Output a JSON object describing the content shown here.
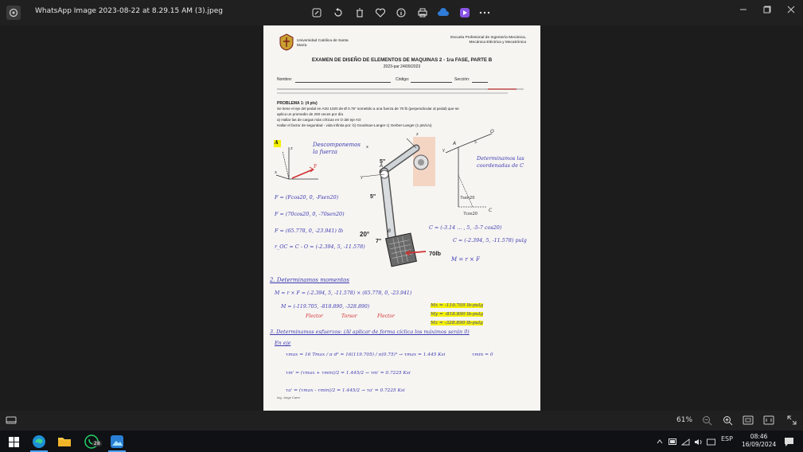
{
  "window": {
    "title": "WhatsApp Image 2023-08-22 at 8.29.15 AM (3).jpeg",
    "toolbar_icons": [
      "edit-icon",
      "rotate-icon",
      "delete-icon",
      "favorite-icon",
      "info-icon",
      "print-icon",
      "cloud-icon",
      "clipchamp-icon",
      "more-icon"
    ]
  },
  "status": {
    "zoom": "61%"
  },
  "taskbar": {
    "lang": "ESP",
    "time": "08:46",
    "date": "16/09/2024",
    "whatsapp_badge": "28"
  },
  "document": {
    "university": "Universidad Católica de Santa María",
    "school": "Escuela Profesional de Ingeniería Mecánica, Mecánica Eléctrica y Mecatrónica",
    "exam_title": "EXAMEN DE DISEÑO DE ELEMENTOS DE MAQUINAS 2 - 1ra FASE, PARTE B",
    "semester": "2023-par    24/09/2023",
    "name_label": "Nombre:",
    "code_label": "Código:",
    "section_label": "Sección:",
    "problem_title": "PROBLEMA 1: (4 pts)",
    "problem_line1": "Se tiene el eje del pedal en AISI 1020 de Ø 0.75\" sometido a una fuerza de 70 lb (perpendicular al pedal) que se",
    "problem_line2": "aplica un promedio de 200 veces por día",
    "problem_line3": "a) Hallar las de cargas más críticas en O del eje AO",
    "problem_line4": "Hallar el factor de seguridad - vida infinita por: b) Goodman-Langer c) Gerber-Langer (1 pts/c/u)",
    "label_force": "70lb",
    "label_5a": "5\"",
    "label_5b": "5\"",
    "label_7": "7\"",
    "label_20": "20°",
    "hw_descompose": "Descomponemos la fuerza",
    "hw_coords": "Determinamos las coordenadas de C",
    "hw_F1": "F = (Fcos20, 0, -Fsen20)",
    "hw_F2": "F = (70cos20, 0, -70sen20)",
    "hw_F3": "F = (65.778, 0, -23.941) lb",
    "hw_roc": "r_OC = C - O = (-2.394, 5, -11.578)",
    "hw_C": "C = (-3.14 ... , 5, -5-7 cos20)",
    "hw_C2": "C = (-2.394, 5, -11.578) pulg",
    "hw_M": "M = r × F",
    "hw_moments": "2. Determinamos momentos",
    "hw_Mcalc": "M = r × F = (-2.394, 5, -11.578) × (65.778, 0, -23.941)",
    "hw_Mres": "M = (-119.705, -818.890, -328.890)",
    "hw_flector": "Flector",
    "hw_torsor": "Torsor",
    "hw_flector2": "Flector",
    "hw_Mx": "Mx = -119.705 lb-pulg",
    "hw_My": "My = -818.890 lb-pulg",
    "hw_Mz": "Mz = -328.890 lb-pulg",
    "hw_stress": "3. Determinamos esfuerzos: (Al aplicar de forma cíclica los máximos serán 0)",
    "hw_tmax": "τmax = 16 Tmax / π d³ = 16(119.705) / π(0.75)³ → τmax = 1.445 Ksi",
    "hw_tmin": "τmin = 0",
    "hw_tm": "τm' = (τmax + τmin)/2 = 1.445/2 → τm' = 0.7225 Ksi",
    "hw_ta": "τa' = (τmax - τmin)/2 = 1.445/2 → τa' = 0.7225 Ksi",
    "hw_sig": "Ing. Jorge Carre",
    "hw_enjeto": "En eje",
    "hw_A": "A"
  }
}
